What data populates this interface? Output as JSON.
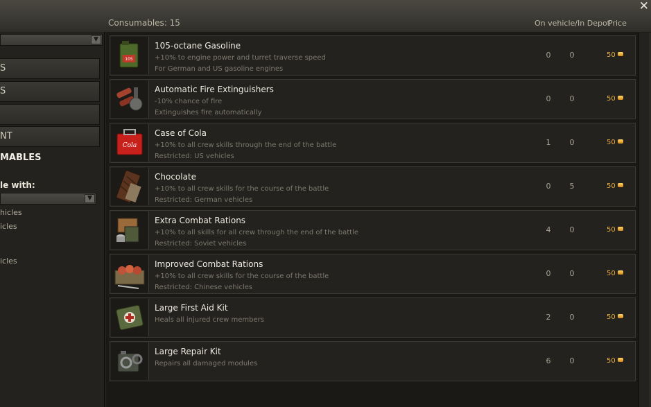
{
  "header": {
    "consumables_count": "Consumables: 15",
    "col_onvehicle": "On vehicle/In Depot",
    "col_price": "Price",
    "close_glyph": "✕"
  },
  "left_panel": {
    "vehicle_select_value": "",
    "nav": [
      {
        "label": "S"
      },
      {
        "label": "S"
      },
      {
        "label": ""
      },
      {
        "label": "NT"
      },
      {
        "label": "MABLES"
      }
    ],
    "filter_label": "le with:",
    "filter_value": "",
    "options": [
      "hicles",
      "icles",
      "icles"
    ]
  },
  "items": [
    {
      "name": "105-octane Gasoline",
      "desc1": "+10% to engine power and turret traverse speed",
      "desc2": "For German and US gasoline engines",
      "on_vehicle": "0",
      "in_depot": "0",
      "price": "50",
      "icon": "gasoline-can-icon"
    },
    {
      "name": "Automatic Fire Extinguishers",
      "desc1": "-10% chance of fire",
      "desc2": "Extinguishes fire automatically",
      "on_vehicle": "0",
      "in_depot": "0",
      "price": "50",
      "icon": "fire-extinguisher-icon"
    },
    {
      "name": "Case of Cola",
      "desc1": "+10% to all crew skills through the end of the battle",
      "desc2": "Restricted: US vehicles",
      "on_vehicle": "1",
      "in_depot": "0",
      "price": "50",
      "icon": "cola-case-icon"
    },
    {
      "name": "Chocolate",
      "desc1": "+10% to all crew skills for the course of the battle",
      "desc2": "Restricted: German vehicles",
      "on_vehicle": "0",
      "in_depot": "5",
      "price": "50",
      "icon": "chocolate-bar-icon"
    },
    {
      "name": "Extra Combat Rations",
      "desc1": "+10% to all skills for all crew through the end of the battle",
      "desc2": "Restricted: Soviet vehicles",
      "on_vehicle": "4",
      "in_depot": "0",
      "price": "50",
      "icon": "rations-crate-icon"
    },
    {
      "name": "Improved Combat Rations",
      "desc1": "+10% to all crew skills for the course of the battle",
      "desc2": "Restricted: Chinese vehicles",
      "on_vehicle": "0",
      "in_depot": "0",
      "price": "50",
      "icon": "food-tray-icon"
    },
    {
      "name": "Large First Aid Kit",
      "desc1": "Heals all injured crew members",
      "desc2": "",
      "on_vehicle": "2",
      "in_depot": "0",
      "price": "50",
      "icon": "first-aid-kit-icon"
    },
    {
      "name": "Large Repair Kit",
      "desc1": "Repairs all damaged modules",
      "desc2": "",
      "on_vehicle": "6",
      "in_depot": "0",
      "price": "50",
      "icon": "repair-kit-icon"
    }
  ]
}
